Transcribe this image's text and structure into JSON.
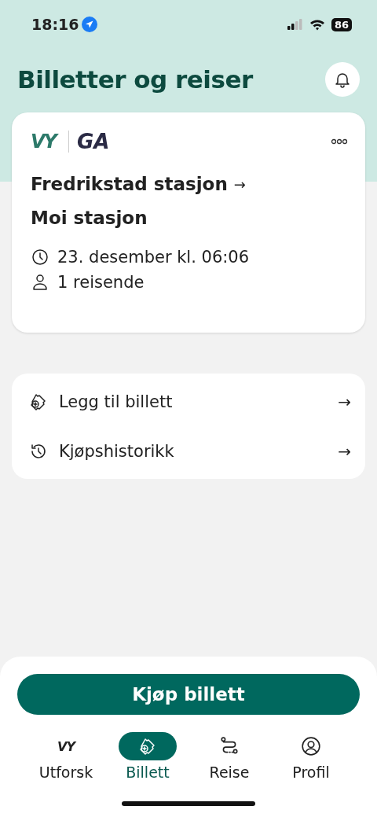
{
  "status_bar": {
    "time": "18:16",
    "battery": "86"
  },
  "header": {
    "title": "Billetter og reiser"
  },
  "ticket": {
    "brand": "VY",
    "product": "GA",
    "from": "Fredrikstad stasjon",
    "arrow": "→",
    "to": "Moi stasjon",
    "departure": "23. desember kl. 06:06",
    "travelers": "1 reisende"
  },
  "actions": [
    {
      "kind": "add",
      "label": "Legg til billett",
      "arrow": "→"
    },
    {
      "kind": "history",
      "label": "Kjøpshistorikk",
      "arrow": "→"
    }
  ],
  "buy_button": "Kjøp billett",
  "tabs": [
    {
      "kind": "logo",
      "logo": "VY",
      "label": "Utforsk",
      "selected": false
    },
    {
      "kind": "ticket",
      "label": "Billett",
      "selected": true
    },
    {
      "kind": "route",
      "label": "Reise",
      "selected": false
    },
    {
      "kind": "profile",
      "label": "Profil",
      "selected": false
    }
  ]
}
